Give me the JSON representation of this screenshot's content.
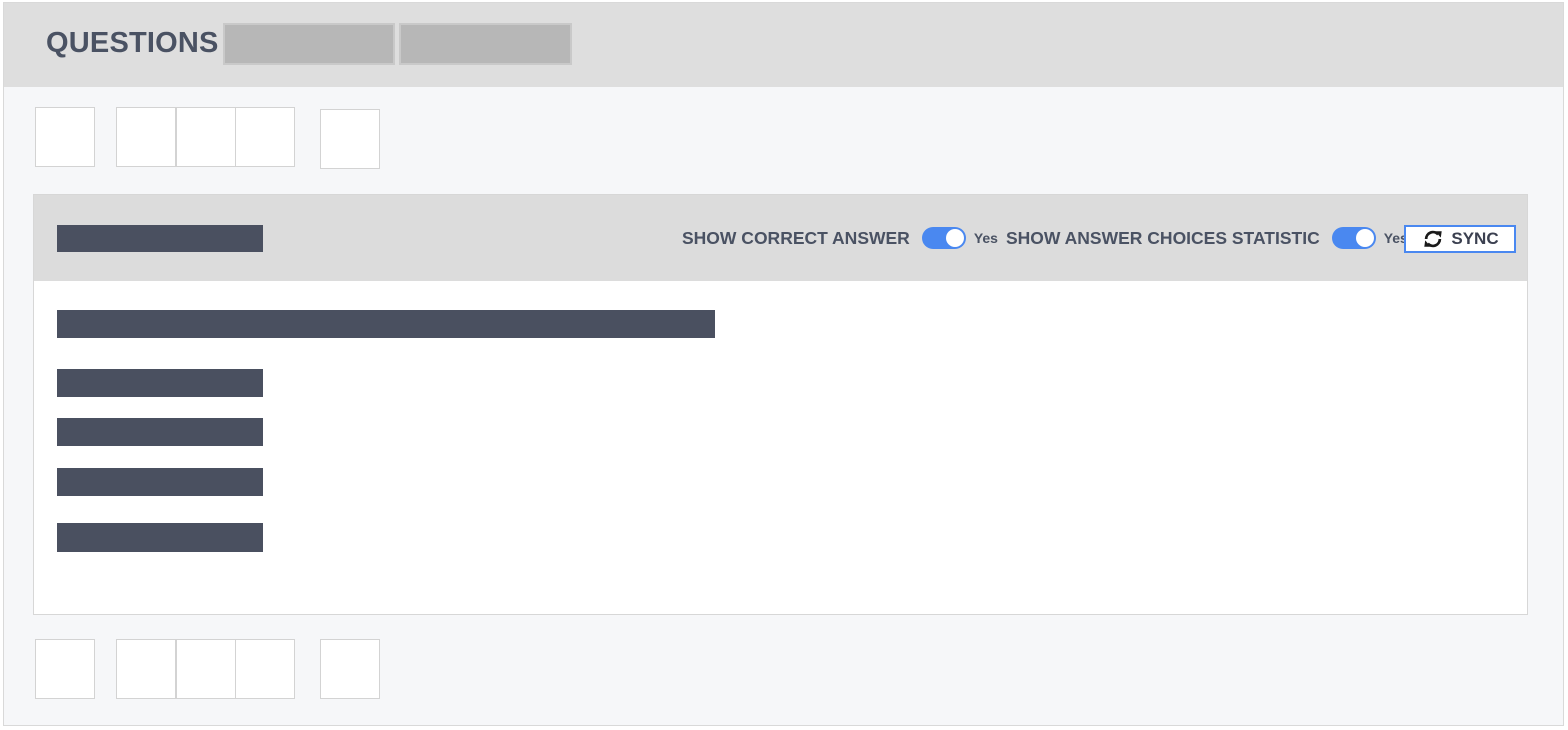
{
  "header": {
    "title": "QUESTIONS"
  },
  "question_card": {
    "show_correct_answer": {
      "label": "SHOW CORRECT ANSWER",
      "state_label": "Yes",
      "enabled": true
    },
    "show_answer_stats": {
      "label": "SHOW ANSWER CHOICES STATISTIC",
      "state_label": "Yes",
      "enabled": true
    },
    "sync_button": {
      "label": "SYNC",
      "icon": "sync-icon"
    }
  },
  "colors": {
    "accent": "#4a88f0",
    "placeholder_dark": "#4a5060",
    "header_bg": "#dedede"
  }
}
